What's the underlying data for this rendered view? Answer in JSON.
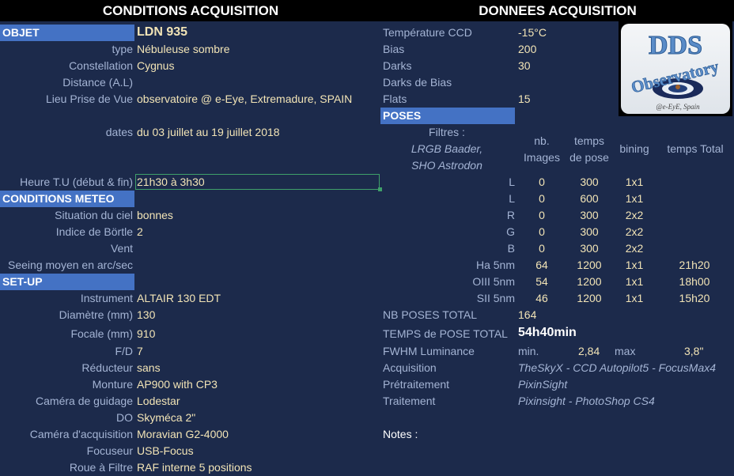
{
  "headers": {
    "left": "CONDITIONS ACQUISITION",
    "right": "DONNEES ACQUISITION"
  },
  "objet": {
    "section": "OBJET",
    "name": "LDN 935",
    "rows": [
      {
        "label": "type",
        "value": "Nébuleuse sombre"
      },
      {
        "label": "Constellation",
        "value": "Cygnus"
      },
      {
        "label": "Distance (A.L)",
        "value": ""
      },
      {
        "label": "Lieu Prise de Vue",
        "value": "observatoire @ e-Eye, Extremadure, SPAIN"
      },
      {
        "label": "dates",
        "value": "du 03 juillet au 19 juillet 2018"
      },
      {
        "label": "Heure T.U (début & fin)",
        "value": "21h30 à 3h30"
      }
    ]
  },
  "meteo": {
    "section": "CONDITIONS METEO",
    "rows": [
      {
        "label": "Situation du ciel",
        "value": "bonnes"
      },
      {
        "label": "Indice de Börtle",
        "value": "2"
      },
      {
        "label": "Vent",
        "value": ""
      },
      {
        "label": "Seeing moyen en arc/sec",
        "value": ""
      }
    ]
  },
  "setup": {
    "section": "SET-UP",
    "rows": [
      {
        "label": "Instrument",
        "value": "ALTAIR 130 EDT"
      },
      {
        "label": "Diamètre (mm)",
        "value": "130"
      },
      {
        "label": "Focale (mm)",
        "value": "910"
      },
      {
        "label": "F/D",
        "value": "7"
      },
      {
        "label": "Réducteur",
        "value": "sans"
      },
      {
        "label": "Monture",
        "value": "AP900 with CP3"
      },
      {
        "label": "Caméra de guidage",
        "value": "Lodestar"
      },
      {
        "label": "DO",
        "value": "Skyméca 2\""
      },
      {
        "label": "Caméra d'acquisition",
        "value": "Moravian G2-4000"
      },
      {
        "label": "Focuseur",
        "value": "USB-Focus"
      },
      {
        "label": "Roue à Filtre",
        "value": "RAF interne 5 positions"
      }
    ]
  },
  "donnees": [
    {
      "label": "Température CCD",
      "value": "-15°C"
    },
    {
      "label": "Bias",
      "value": "200"
    },
    {
      "label": "Darks",
      "value": "30"
    },
    {
      "label": "Darks de Bias",
      "value": ""
    },
    {
      "label": "Flats",
      "value": "15"
    }
  ],
  "logo": {
    "line1": "DDS",
    "line2": "Observatory",
    "line3": "@e-EyE, Spain"
  },
  "poses": {
    "section": "POSES",
    "filters_title": "Filtres :",
    "filters_line1": "LRGB Baader,",
    "filters_line2": "SHO Astrodon",
    "columns": {
      "nb": "nb. Images",
      "nb1": "nb.",
      "nb2": "Images",
      "tp1": "temps",
      "tp2": "de pose",
      "bining": "bining",
      "total": "temps Total"
    },
    "rows": [
      {
        "filter": "L",
        "nb": "0",
        "pose": "300",
        "bining": "1x1",
        "total": ""
      },
      {
        "filter": "L",
        "nb": "0",
        "pose": "600",
        "bining": "1x1",
        "total": ""
      },
      {
        "filter": "R",
        "nb": "0",
        "pose": "300",
        "bining": "2x2",
        "total": ""
      },
      {
        "filter": "G",
        "nb": "0",
        "pose": "300",
        "bining": "2x2",
        "total": ""
      },
      {
        "filter": "B",
        "nb": "0",
        "pose": "300",
        "bining": "2x2",
        "total": ""
      },
      {
        "filter": "Ha 5nm",
        "nb": "64",
        "pose": "1200",
        "bining": "1x1",
        "total": "21h20"
      },
      {
        "filter": "OIII 5nm",
        "nb": "54",
        "pose": "1200",
        "bining": "1x1",
        "total": "18h00"
      },
      {
        "filter": "SII 5nm",
        "nb": "46",
        "pose": "1200",
        "bining": "1x1",
        "total": "15h20"
      }
    ]
  },
  "totals": {
    "nb_label": "NB POSES TOTAL",
    "nb_value": "164",
    "temps_label": "TEMPS de POSE TOTAL",
    "temps_value": "54h40min",
    "fwhm_label": "FWHM Luminance",
    "fwhm_min_label": "min.",
    "fwhm_min": "2,84",
    "fwhm_max_label": "max",
    "fwhm_max": "3,8\"",
    "acq_label": "Acquisition",
    "acq_value": "TheSkyX - CCD Autopilot5 - FocusMax4",
    "pre_label": "Prétraitement",
    "pre_value": "PixinSight",
    "trait_label": "Traitement",
    "trait_value": "Pixinsight - PhotoShop CS4",
    "notes_label": "Notes :"
  }
}
